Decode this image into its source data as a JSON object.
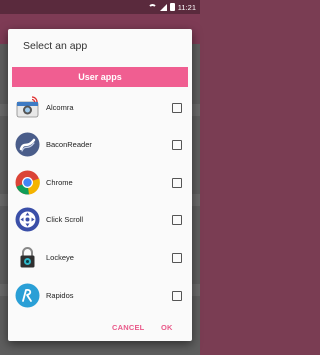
{
  "status_bar": {
    "time": "11:21"
  },
  "dialog": {
    "title": "Select an app",
    "section_header": "User apps",
    "apps": [
      {
        "label": "Alcomra",
        "icon": "alcomra-camera-icon",
        "checked": false
      },
      {
        "label": "BaconReader",
        "icon": "baconreader-icon",
        "checked": false
      },
      {
        "label": "Chrome",
        "icon": "chrome-icon",
        "checked": false
      },
      {
        "label": "Click Scroll",
        "icon": "click-scroll-icon",
        "checked": false
      },
      {
        "label": "Lockeye",
        "icon": "lockeye-padlock-icon",
        "checked": false
      },
      {
        "label": "Rapidos",
        "icon": "rapidos-icon",
        "checked": false
      }
    ],
    "cancel_label": "CANCEL",
    "ok_label": "OK"
  },
  "colors": {
    "accent": "#f05e91",
    "app_bar": "#7e3b55",
    "status_bar": "#5a2a3d"
  }
}
